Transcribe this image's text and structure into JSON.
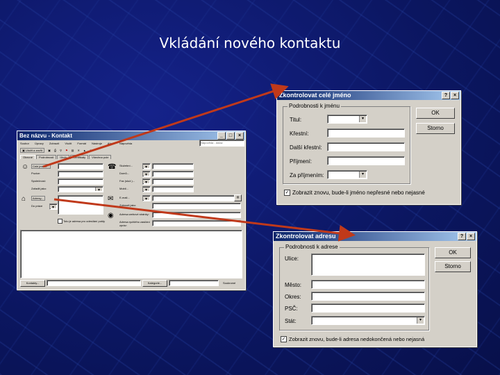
{
  "slide": {
    "title": "Vkládání nového kontaktu"
  },
  "contact_window": {
    "title": "Bez názvu - Kontakt",
    "menu": [
      "Soubor",
      "Úpravy",
      "Zobrazit",
      "Vložit",
      "Formát",
      "Nástroje",
      "Akce",
      "Nápověda"
    ],
    "toolbar": {
      "save_close": "Uložit a zavřít"
    },
    "search_placeholder": "Nápověda - dotaz",
    "tabs": [
      "Obecné",
      "Podrobnosti",
      "Úkoly",
      "Certifikáty",
      "Všechna pole"
    ],
    "left_labels": [
      "Celé jméno...",
      "Pozice:",
      "Společnost:",
      "Zařadit jako:"
    ],
    "right_labels": [
      "Služební...",
      "Domů...",
      "Fax (služ.)...",
      "Mobil..."
    ],
    "address_label": "Adresy...",
    "address_type": "Do práce",
    "mail_label": "E-mail...",
    "display_as": "Zobrazit jako:",
    "web_page": "Adresa webové stránky:",
    "im_address": "Adresa rychlého zasílání zpráv:",
    "mail_checkbox": "Toto je adresa pro odesílání pošty",
    "contacts_button": "Kontakty...",
    "categories_button": "Kategorie...",
    "private_label": "Soukromé"
  },
  "name_dialog": {
    "title": "Zkontrolovat celé jméno",
    "group": "Podrobnosti k jménu",
    "labels": [
      "Titul:",
      "Křestní:",
      "Další křestní:",
      "Příjmení:",
      "Za příjmením:"
    ],
    "ok": "OK",
    "cancel": "Storno",
    "checkbox": "Zobrazit znovu, bude-li jméno nepřesné nebo nejasné"
  },
  "address_dialog": {
    "title": "Zkontrolovat adresu",
    "group": "Podrobnosti k adrese",
    "labels": [
      "Ulice:",
      "Město:",
      "Okres:",
      "PSČ:",
      "Stát:"
    ],
    "ok": "OK",
    "cancel": "Storno",
    "checkbox": "Zobrazit znovu, bude-li adresa nedokončená nebo nejasná"
  },
  "colors": {
    "background": "#0b1660",
    "arrow": "#c0391a",
    "titlebar": "#0a246a"
  }
}
